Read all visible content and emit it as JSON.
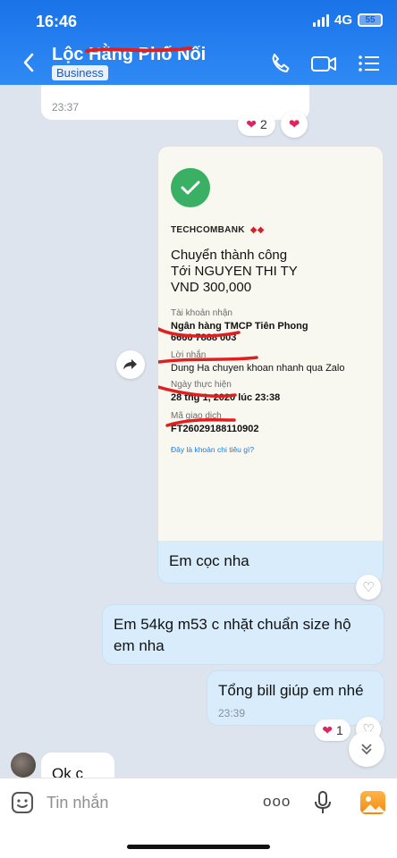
{
  "status_bar": {
    "time": "16:46",
    "network": "4G",
    "battery": "55"
  },
  "header": {
    "contact_name": "Lộc Hằng Phố Nối",
    "badge": "Business",
    "icons": [
      "back-icon",
      "phone-icon",
      "video-call-icon",
      "menu-list-icon"
    ]
  },
  "messages": {
    "prev_received_time": "23:37",
    "prev_reaction_count": "2",
    "receipt": {
      "bank": "TECHCOMBANK",
      "title_line1": "Chuyển thành công",
      "title_line2": "Tới NGUYEN THI TY",
      "title_line3": "VND 300,000",
      "account_label": "Tài khoản nhận",
      "account_bank": "Ngân hàng TMCP Tiên Phong",
      "account_number": "6666 7888 003",
      "message_label": "Lời nhắn",
      "message_value": "Dung Ha chuyen khoan nhanh qua Zalo",
      "date_label": "Ngày thực hiện",
      "date_value": "28 thg 1, 2020 lúc 23:38",
      "txn_label": "Mã giao dịch",
      "txn_value": "FT26029188110902",
      "link": "Đây là khoản chi tiêu gì?"
    },
    "caption": "Em cọc nha",
    "sent_2": "Em 54kg m53 c nhặt chuẩn size hộ em nha",
    "sent_3": "Tổng bill giúp em nhé",
    "sent_3_time": "23:39",
    "sent_3_reaction_count": "1",
    "received_last": "Ok c"
  },
  "input": {
    "placeholder": "Tin nhắn",
    "more": "ooo"
  },
  "colors": {
    "header": "#1a73e8",
    "sent_bubble": "#d9ecfb",
    "background": "#dde4ee",
    "heart": "#e0245e",
    "success": "#3ab065",
    "techcombank_red": "#e31b23"
  }
}
